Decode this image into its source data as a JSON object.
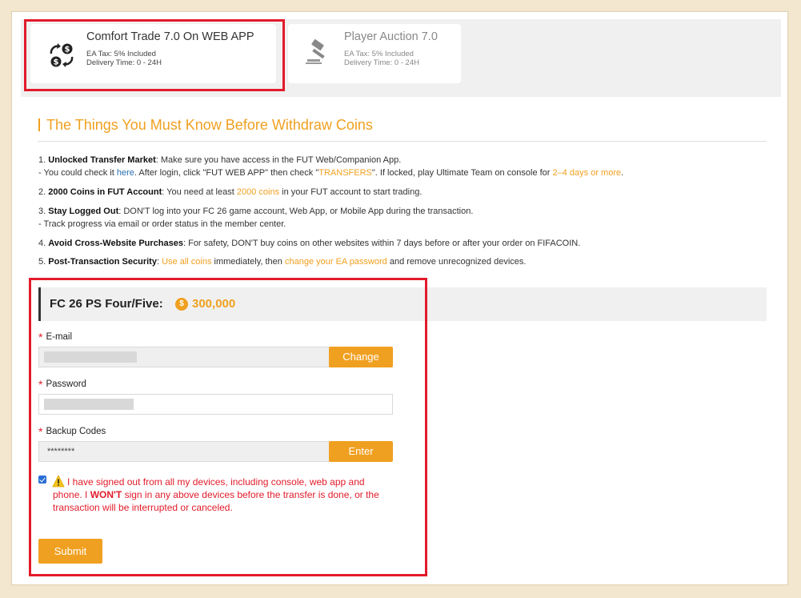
{
  "tabs": [
    {
      "title": "Comfort Trade 7.0 On WEB APP",
      "tax": "EA Tax: 5% Included",
      "delivery": "Delivery Time: 0 - 24H",
      "icon": "coins-exchange-icon"
    },
    {
      "title": "Player Auction 7.0",
      "tax": "EA Tax: 5% Included",
      "delivery": "Delivery Time: 0 - 24H",
      "icon": "auction-gavel-icon"
    }
  ],
  "section": {
    "title": "The Things You Must Know Before Withdraw Coins"
  },
  "notes": {
    "n1_num": "1.",
    "n1_bold": "Unlocked Transfer Market",
    "n1_text": ": Make sure you have access in the FUT Web/Companion App.",
    "n1b_a": "- You could check it ",
    "n1b_link": "here",
    "n1b_b": ". After login, click \"FUT WEB APP\" then check \"",
    "n1b_transfers": "TRANSFERS",
    "n1b_c": "\". If locked, play Ultimate Team on console for ",
    "n1b_days": "2–4 days or more",
    "n1b_d": ".",
    "n2_num": "2.",
    "n2_bold": "2000 Coins in FUT Account",
    "n2_a": ": You need at least ",
    "n2_coins": "2000 coins",
    "n2_b": " in your FUT account to start trading.",
    "n3_num": "3.",
    "n3_bold": "Stay Logged Out",
    "n3_text": ": DON'T log into your FC 26 game account, Web App, or Mobile App during the transaction.",
    "n3b": "- Track progress via email or order status in the member center.",
    "n4_num": "4.",
    "n4_bold": "Avoid Cross-Website Purchases",
    "n4_text": ": For safety, DON'T buy coins on other websites within 7 days before or after your order on FIFACOIN.",
    "n5_num": "5.",
    "n5_bold": "Post-Transaction Security",
    "n5_a": ": ",
    "n5_use": "Use all coins",
    "n5_b": " immediately, then ",
    "n5_change": "change your EA password",
    "n5_c": " and remove unrecognized devices."
  },
  "form": {
    "header_label": "FC 26 PS Four/Five:",
    "coin_symbol": "$",
    "amount": "300,000",
    "email_label": "E-mail",
    "change_btn": "Change",
    "password_label": "Password",
    "backup_label": "Backup Codes",
    "backup_value": "********",
    "enter_btn": "Enter",
    "agree_a": "I have signed out from all my devices, including console, web app and phone. I ",
    "agree_bold": "WON'T",
    "agree_b": " sign in any above devices before the transfer is done, or the transaction will be interrupted or canceled.",
    "submit_btn": "Submit",
    "checked": true
  },
  "colors": {
    "accent": "#f0a020",
    "highlight": "#e21b2a",
    "link": "#2a6fb0"
  }
}
